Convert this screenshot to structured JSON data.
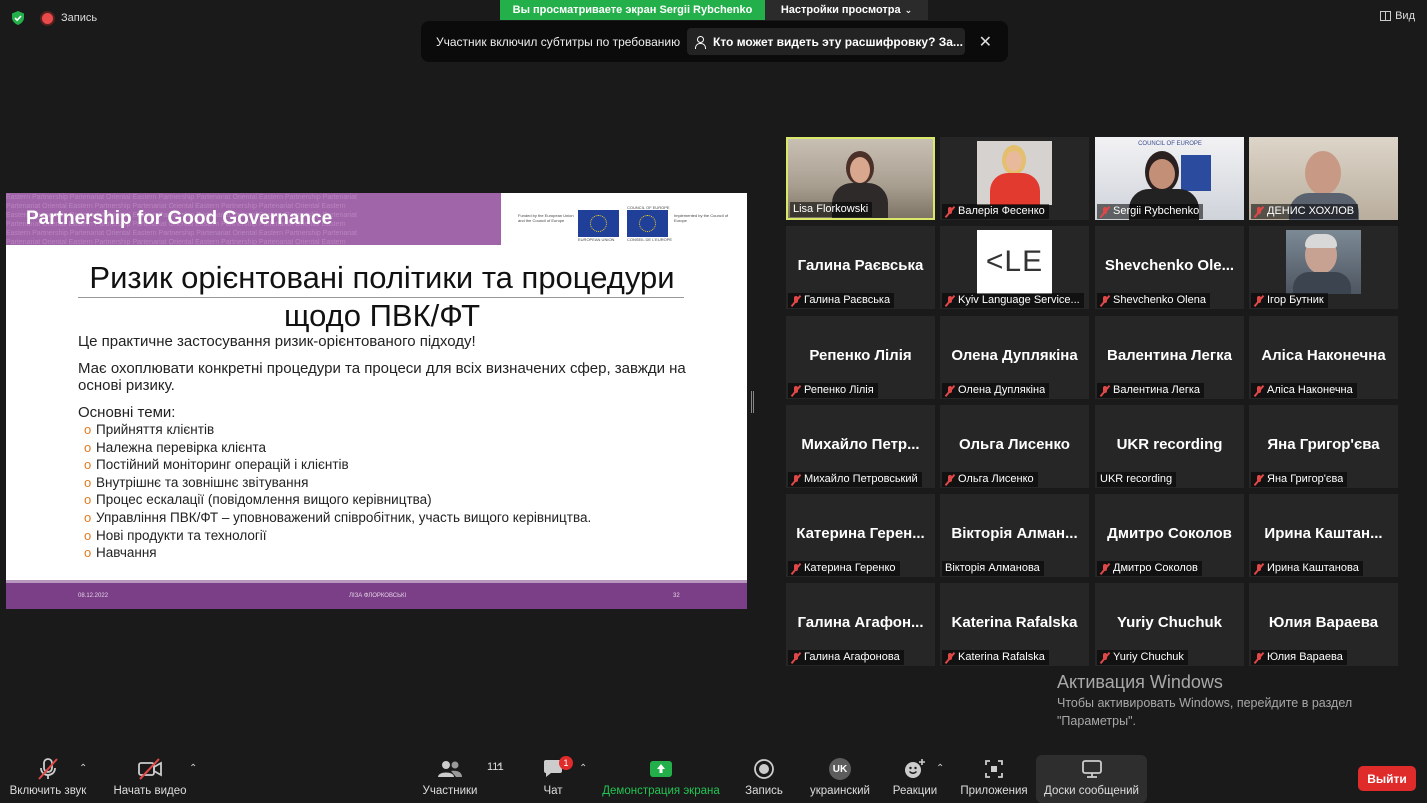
{
  "topbar": {
    "recording_label": "Запись",
    "viewing_banner": "Вы просматриваете экран Sergii Rybchenko",
    "view_settings": "Настройки просмотра",
    "view_button": "Вид"
  },
  "captions": {
    "notice": "Участник включил субтитры по требованию",
    "who_can_see": "Кто может видеть эту расшифровку? За..."
  },
  "slide": {
    "header_title": "Partnership for Good Governance",
    "logo_eu_text": "Funded by the European Union and the Council of Europe",
    "logo_eu_caption": "EUROPEAN UNION",
    "logo_coe_top": "COUNCIL OF EUROPE",
    "logo_coe_caption": "CONSEIL DE L'EUROPE",
    "logo_impl_text": "Implemented by the Council of Europe",
    "title": "Ризик орієнтовані політики та процедури щодо ПВК/ФТ",
    "para1": "Це практичне застосування ризик-орієнтованого підходу!",
    "para2": "Має охоплювати конкретні процедури та процеси для всіх визначених сфер, завжди на основі ризику.",
    "topics_label": "Основні теми:",
    "topics": [
      "Прийняття клієнтів",
      "Належна перевірка клієнта",
      "Постійний моніторинг операцій і клієнтів",
      "Внутрішнє та зовнішнє звітування",
      "Процес ескалації (повідомлення вищого керівництва)",
      "Управління ПВК/ФТ – уповноважений співробітник, участь вищого керівництва.",
      "Нові продукти та технології",
      "Навчання"
    ],
    "footer_date": "08.12.2022",
    "footer_author": "ЛІЗА ФЛОРКОВСЬКІ",
    "footer_page": "32"
  },
  "gallery": [
    {
      "name": "",
      "label": "Lisa Florkowski",
      "muted": false,
      "video": "woman"
    },
    {
      "name": "",
      "label": "Валерія Фесенко",
      "muted": true,
      "video": "red"
    },
    {
      "name": "",
      "label": "Sergii Rybchenko",
      "muted": true,
      "video": "man-coe"
    },
    {
      "name": "",
      "label": "ДЕНИС ХОХЛОВ",
      "muted": true,
      "video": "man-bald"
    },
    {
      "name": "Галина Раєвська",
      "label": "Галина Раєвська",
      "muted": true
    },
    {
      "name": "",
      "label": "Kyiv Language Service...",
      "muted": true,
      "video": "kls"
    },
    {
      "name": "Shevchenko Ole...",
      "label": "Shevchenko Olena",
      "muted": true
    },
    {
      "name": "",
      "label": "Ігор Бутник",
      "muted": true,
      "video": "man-grey"
    },
    {
      "name": "Репенко Лілія",
      "label": "Репенко Лілія",
      "muted": true
    },
    {
      "name": "Олена Дуплякіна",
      "label": "Олена Дуплякіна",
      "muted": true
    },
    {
      "name": "Валентина Легка",
      "label": "Валентина Легка",
      "muted": true
    },
    {
      "name": "Аліса Наконечна",
      "label": "Аліса Наконечна",
      "muted": true
    },
    {
      "name": "Михайло Петр...",
      "label": "Михайло Петровський",
      "muted": true
    },
    {
      "name": "Ольга Лисенко",
      "label": "Ольга Лисенко",
      "muted": true
    },
    {
      "name": "UKR recording",
      "label": "UKR recording",
      "muted": false
    },
    {
      "name": "Яна Григор'єва",
      "label": "Яна Григор'єва",
      "muted": true
    },
    {
      "name": "Катерина Герен...",
      "label": "Катерина Геренко",
      "muted": true
    },
    {
      "name": "Вікторія Алман...",
      "label": "Вікторія Алманова",
      "muted": false
    },
    {
      "name": "Дмитро Соколов",
      "label": "Дмитро Соколов",
      "muted": true
    },
    {
      "name": "Ирина Каштан...",
      "label": "Ирина Каштанова",
      "muted": true
    },
    {
      "name": "Галина Агафон...",
      "label": "Галина Агафонова",
      "muted": true
    },
    {
      "name": "Katerina Rafalska",
      "label": "Katerina Rafalska",
      "muted": true
    },
    {
      "name": "Yuriy Chuchuk",
      "label": "Yuriy Chuchuk",
      "muted": true
    },
    {
      "name": "Юлия Вараева",
      "label": "Юлия Вараева",
      "muted": true
    }
  ],
  "activation": {
    "title": "Активация Windows",
    "subtitle": "Чтобы активировать Windows, перейдите в раздел \"Параметры\"."
  },
  "toolbar": {
    "unmute": "Включить звук",
    "start_video": "Начать видео",
    "participants_count": "111",
    "participants": "Участники",
    "chat": "Чат",
    "chat_badge": "1",
    "share_screen": "Демонстрация экрана",
    "record": "Запись",
    "language_code": "UK",
    "language": "украинский",
    "reactions": "Реакции",
    "apps": "Приложения",
    "whiteboards": "Доски сообщений",
    "leave": "Выйти"
  },
  "colors": {
    "accent_green": "#23b04a",
    "slide_purple": "#a065a8",
    "leave_red": "#e02b2b",
    "active_speaker": "#d9e86a"
  }
}
